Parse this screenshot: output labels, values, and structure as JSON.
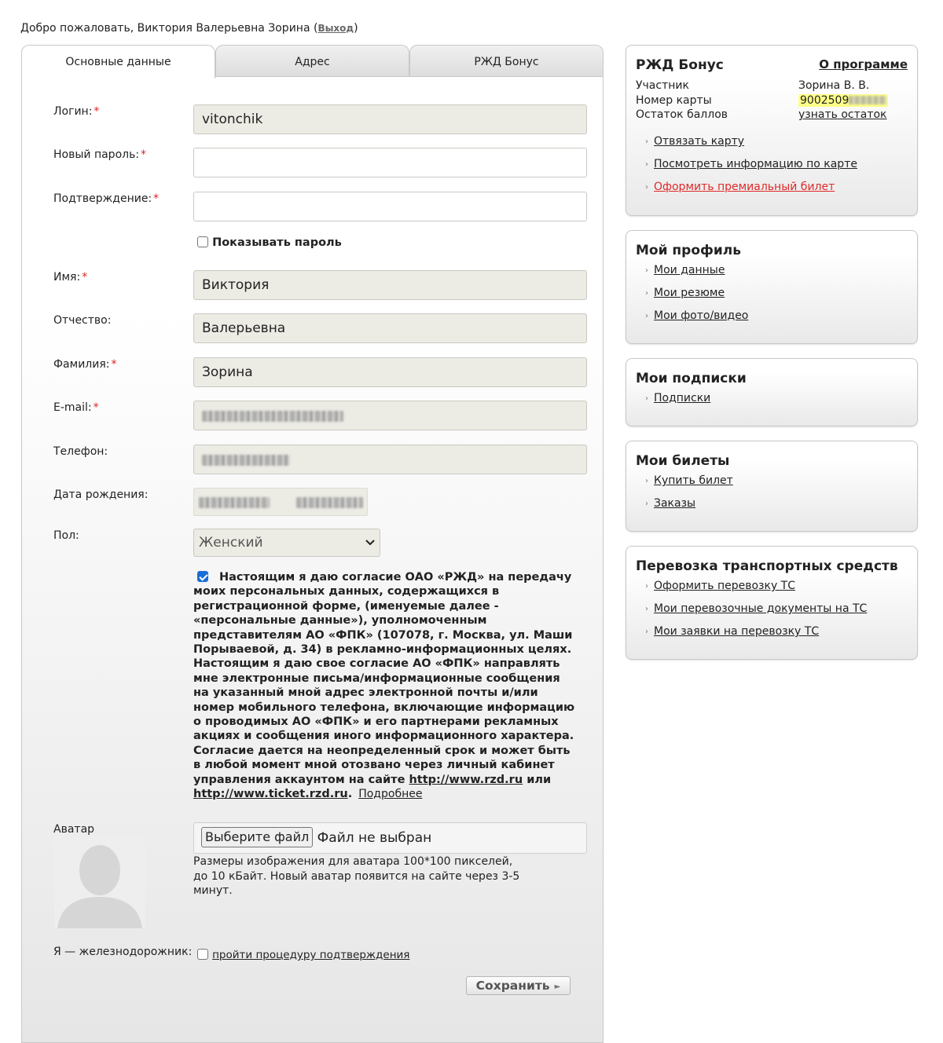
{
  "header": {
    "welcome_text": "Добро пожаловать, Виктория Валерьевна Зорина (",
    "logout_label": "Выход",
    "welcome_close": ")"
  },
  "tabs": [
    {
      "label": "Основные данные",
      "active": true
    },
    {
      "label": "Адрес",
      "active": false
    },
    {
      "label": "РЖД Бонус",
      "active": false
    }
  ],
  "form": {
    "login": {
      "label": "Логин:",
      "value": "vitonchik"
    },
    "new_password": {
      "label": "Новый пароль:",
      "value": ""
    },
    "confirm": {
      "label": "Подтверждение:",
      "value": ""
    },
    "show_password": {
      "label": "Показывать пароль",
      "checked": false
    },
    "first_name": {
      "label": "Имя:",
      "value": "Виктория"
    },
    "patronymic": {
      "label": "Отчество:",
      "value": "Валерьевна"
    },
    "last_name": {
      "label": "Фамилия:",
      "value": "Зорина"
    },
    "email": {
      "label": "E-mail:"
    },
    "phone": {
      "label": "Телефон:"
    },
    "birth_date": {
      "label": "Дата рождения:"
    },
    "gender": {
      "label": "Пол:",
      "value": "Женский"
    },
    "required_mark": "*",
    "consent": {
      "checked": true,
      "text": "Настоящим я даю согласие ОАО «РЖД» на передачу моих персональных данных, содержащихся в регистрационной форме, (именуемые далее - «персональные данные»), уполномоченным представителям АО «ФПК» (107078, г. Москва, ул. Маши Порываевой, д. 34) в рекламно-информационных целях. Настоящим я даю свое согласие АО «ФПК» направлять мне электронные письма/информационные сообщения на указанный мной адрес электронной почты и/или номер мобильного телефона, включающие информацию о проводимых АО «ФПК» и его партнерами рекламных акциях и сообщения иного информационного характера. Согласие дается на неопределенный срок и может быть в любой момент мной отозвано через личный кабинет управления аккаунтом на сайте ",
      "link1": "http://www.rzd.ru",
      "or": " или ",
      "link2": "http://www.ticket.rzd.ru",
      "dot": ".",
      "more": "Подробнее"
    },
    "avatar": {
      "label": "Аватар",
      "button": "Выберите файл",
      "no_file": "Файл не выбран",
      "hint": "Размеры изображения для аватара 100*100 пикселей, до 10 кБайт. Новый аватар появится на сайте через 3-5 минут."
    },
    "railway": {
      "label": "Я — железнодорожник:",
      "link": "пройти процедуру подтверждения",
      "checked": false
    },
    "save_label": "Сохранить"
  },
  "sidebar": {
    "bonus": {
      "title": "РЖД Бонус",
      "about": "О программе",
      "member_label": "Участник",
      "member_value": "Зорина  В.  В.",
      "card_label": "Номер карты",
      "card_value": "9002509",
      "balance_label": "Остаток баллов",
      "balance_link": "узнать остаток",
      "links": [
        {
          "label": "Отвязать карту",
          "red": false
        },
        {
          "label": "Посмотреть информацию по карте",
          "red": false
        },
        {
          "label": "Оформить премиальный билет",
          "red": true
        }
      ]
    },
    "profile": {
      "title": "Мой профиль",
      "links": [
        {
          "label": "Мои данные"
        },
        {
          "label": "Мои резюме"
        },
        {
          "label": "Мои фото/видео"
        }
      ]
    },
    "subscriptions": {
      "title": "Мои подписки",
      "links": [
        {
          "label": "Подписки"
        }
      ]
    },
    "tickets": {
      "title": "Мои билеты",
      "links": [
        {
          "label": "Купить билет"
        },
        {
          "label": "Заказы"
        }
      ]
    },
    "transport": {
      "title": "Перевозка транспортных средств",
      "links": [
        {
          "label": "Оформить перевозку ТС"
        },
        {
          "label": "Мои перевозочные документы на ТС"
        },
        {
          "label": "Мои заявки на перевозку ТС"
        }
      ]
    }
  },
  "colors": {
    "required": "#dd2222",
    "link_red": "#e02a2a",
    "highlight": "#ffff88",
    "accent_checkbox": "#1a6dd6"
  },
  "icons": [
    "chevron-down-icon",
    "bullet-arrow-icon",
    "avatar-placeholder-icon",
    "arrow-right-icon"
  ]
}
